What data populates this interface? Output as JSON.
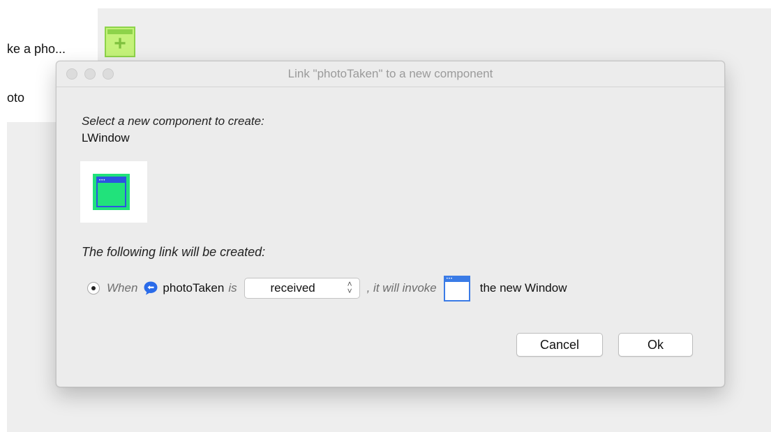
{
  "background": {
    "text_line_1": "ke a pho...",
    "text_line_2": "oto",
    "icon": "window-add-icon"
  },
  "dialog": {
    "title": "Link \"photoTaken\" to a new component",
    "select_prompt": "Select a new component to create:",
    "component_name": "LWindow",
    "component_icon": "window-icon",
    "link_prompt": "The following link will be created:",
    "link": {
      "when": "When",
      "event_icon": "message-bubble-icon",
      "event_name": "photoTaken",
      "is": "is",
      "selected_state": "received",
      "invoke": ", it will invoke",
      "target_icon": "window-icon",
      "target": "the new Window"
    },
    "buttons": {
      "cancel": "Cancel",
      "ok": "Ok"
    }
  },
  "colors": {
    "accent_green": "#21e27b",
    "icon_blue": "#2c55e0",
    "bubble_blue": "#2a6be9",
    "lime": "#c4f27a"
  }
}
